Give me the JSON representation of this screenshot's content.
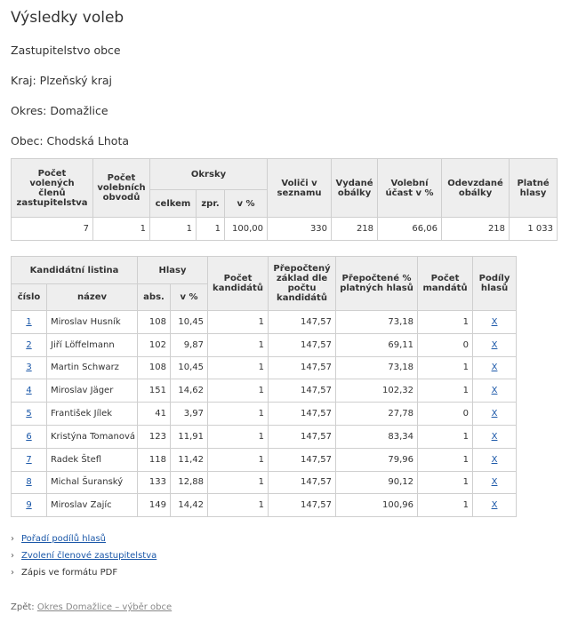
{
  "page": {
    "title": "Výsledky voleb",
    "body_type": "Zastupitelstvo obce",
    "region": "Kraj: Plzeňský kraj",
    "district": "Okres: Domažlice",
    "municipality": "Obec: Chodská Lhota"
  },
  "summary": {
    "headers": {
      "elected_members": "Počet volených členů zastupitelstva",
      "districts_count": "Počet volebních obvodů",
      "precincts": "Okrsky",
      "precincts_total": "celkem",
      "precincts_processed": "zpr.",
      "precincts_pct": "v %",
      "voters": "Voliči v seznamu",
      "envelopes_issued": "Vydané obálky",
      "turnout": "Volební účast v %",
      "envelopes_returned": "Odevzdané obálky",
      "valid_votes": "Platné hlasy"
    },
    "values": {
      "elected_members": "7",
      "districts_count": "1",
      "precincts_total": "1",
      "precincts_processed": "1",
      "precincts_pct": "100,00",
      "voters": "330",
      "envelopes_issued": "218",
      "turnout": "66,06",
      "envelopes_returned": "218",
      "valid_votes": "1 033"
    }
  },
  "parties": {
    "headers": {
      "list": "Kandidátní listina",
      "votes": "Hlasy",
      "candidates": "Počet kandidátů",
      "recalc_base": "Přepočtený základ dle počtu kandidátů",
      "recalc_pct": "Přepočtené % platných hlasů",
      "mandates": "Počet mandátů",
      "shares": "Podíly hlasů",
      "number": "číslo",
      "name": "název",
      "abs": "abs.",
      "pct": "v %"
    },
    "rows": [
      {
        "num": "1",
        "name": "Miroslav Husník",
        "abs": "108",
        "pct": "10,45",
        "cand": "1",
        "base": "147,57",
        "rpct": "73,18",
        "mand": "1",
        "share": "X"
      },
      {
        "num": "2",
        "name": "Jiří Löffelmann",
        "abs": "102",
        "pct": "9,87",
        "cand": "1",
        "base": "147,57",
        "rpct": "69,11",
        "mand": "0",
        "share": "X"
      },
      {
        "num": "3",
        "name": "Martin Schwarz",
        "abs": "108",
        "pct": "10,45",
        "cand": "1",
        "base": "147,57",
        "rpct": "73,18",
        "mand": "1",
        "share": "X"
      },
      {
        "num": "4",
        "name": "Miroslav Jäger",
        "abs": "151",
        "pct": "14,62",
        "cand": "1",
        "base": "147,57",
        "rpct": "102,32",
        "mand": "1",
        "share": "X"
      },
      {
        "num": "5",
        "name": "František Jílek",
        "abs": "41",
        "pct": "3,97",
        "cand": "1",
        "base": "147,57",
        "rpct": "27,78",
        "mand": "0",
        "share": "X"
      },
      {
        "num": "6",
        "name": "Kristýna Tomanová",
        "abs": "123",
        "pct": "11,91",
        "cand": "1",
        "base": "147,57",
        "rpct": "83,34",
        "mand": "1",
        "share": "X"
      },
      {
        "num": "7",
        "name": "Radek Štefl",
        "abs": "118",
        "pct": "11,42",
        "cand": "1",
        "base": "147,57",
        "rpct": "79,96",
        "mand": "1",
        "share": "X"
      },
      {
        "num": "8",
        "name": "Michal Šuranský",
        "abs": "133",
        "pct": "12,88",
        "cand": "1",
        "base": "147,57",
        "rpct": "90,12",
        "mand": "1",
        "share": "X"
      },
      {
        "num": "9",
        "name": "Miroslav Zajíc",
        "abs": "149",
        "pct": "14,42",
        "cand": "1",
        "base": "147,57",
        "rpct": "100,96",
        "mand": "1",
        "share": "X"
      }
    ]
  },
  "links": [
    {
      "label": "Pořadí podílů hlasů",
      "link": true
    },
    {
      "label": "Zvolení členové zastupitelstva",
      "link": true
    },
    {
      "label": "Zápis ve formátu PDF",
      "link": false
    }
  ],
  "footer": {
    "back_label": "Zpět:",
    "back_link": "Okres Domažlice – výběr obce"
  },
  "colors": {
    "link": "#1a57a8",
    "header_bg": "#eeeeee",
    "border": "#cfcfcf"
  },
  "icons": {
    "list_bullet": "chevron-right-icon"
  }
}
